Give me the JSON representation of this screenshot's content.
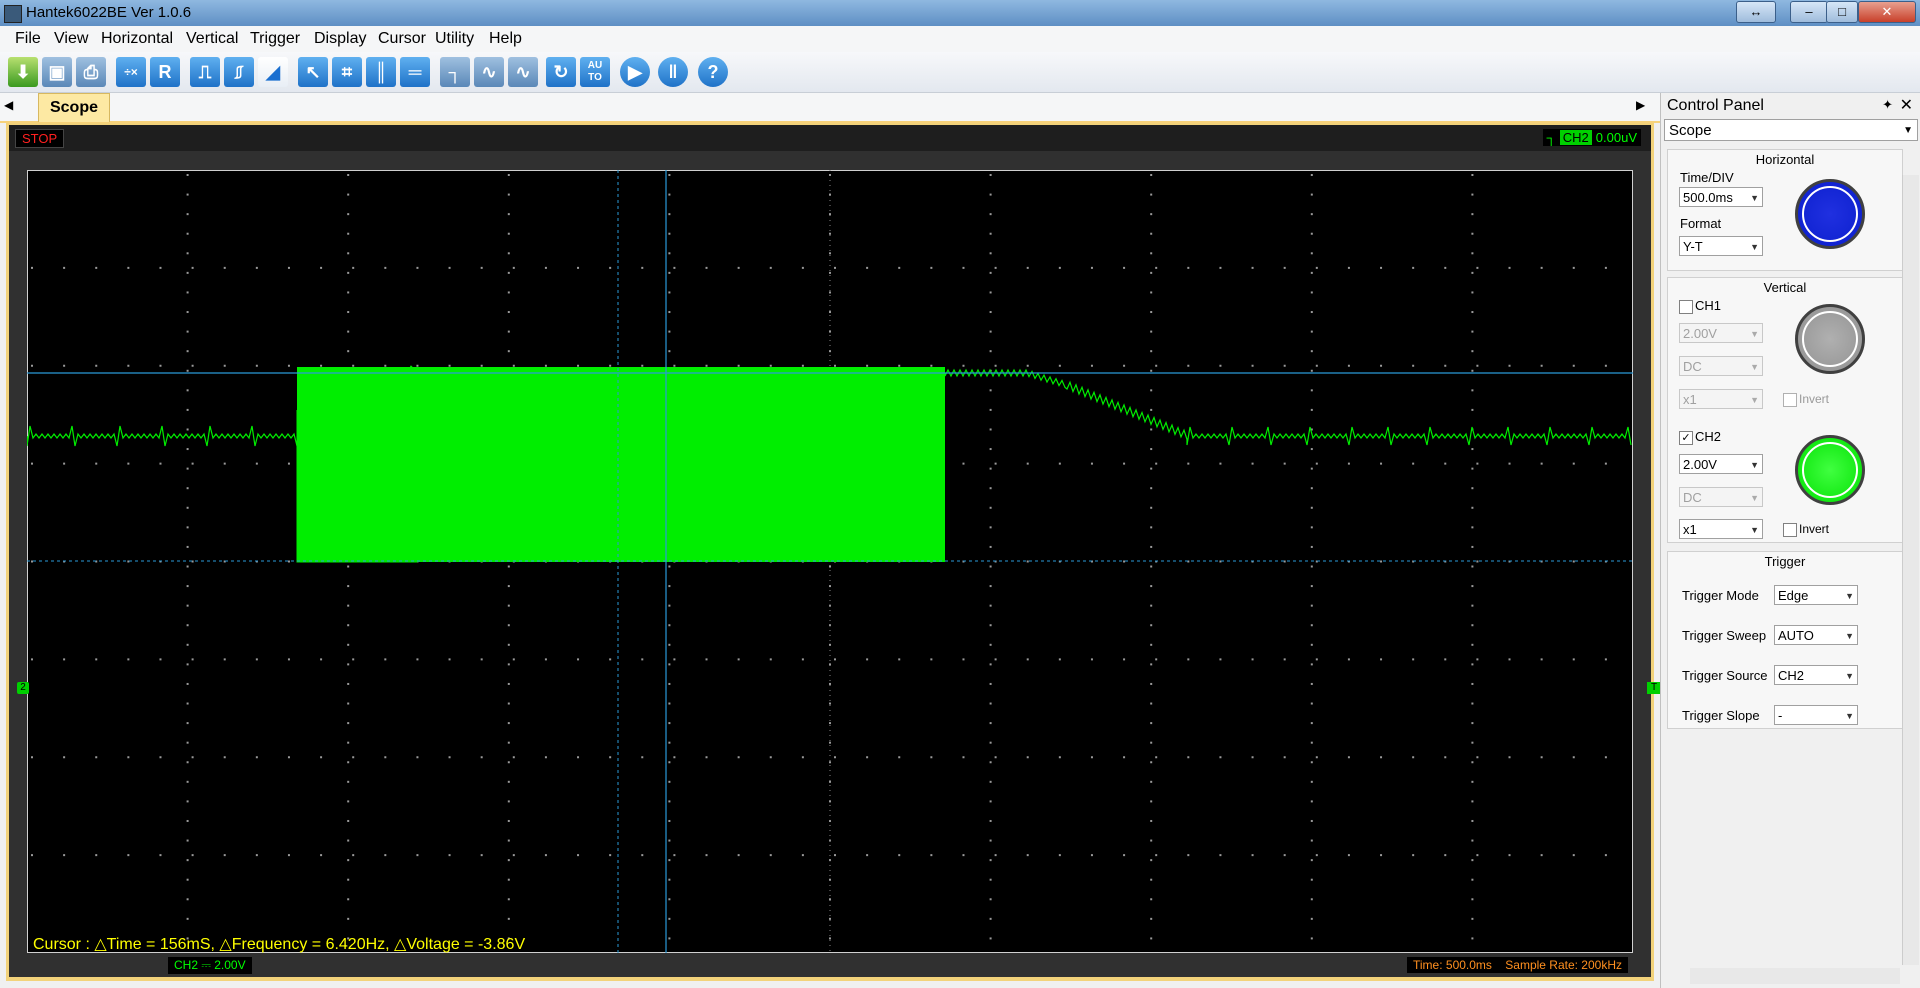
{
  "window": {
    "title": "Hantek6022BE Ver 1.0.6"
  },
  "menu": [
    "File",
    "View",
    "Horizontal",
    "Vertical",
    "Trigger",
    "Cursor",
    "Display",
    "Cursor",
    "Utility",
    "Help"
  ],
  "menu_items": {
    "file": "File",
    "view": "View",
    "horizontal": "Horizontal",
    "vertical": "Vertical",
    "trigger": "Trigger",
    "display": "Display",
    "cursor": "Cursor",
    "utility": "Utility",
    "help": "Help"
  },
  "toolbar": {
    "r_label": "R",
    "auto_label": "AU\nTO",
    "help_label": "?"
  },
  "tabs": {
    "scope": "Scope"
  },
  "scope": {
    "status": "STOP",
    "trigger_channel": "CH2",
    "trigger_level": "0.00uV",
    "cursor_readout": "Cursor : △Time = 156mS, △Frequency = 6.420Hz, △Voltage = -3.86V",
    "ch2_scale": "CH2 ⎓  2.00V",
    "time_div": "Time: 500.0ms",
    "sample_rate": "Sample Rate: 200kHz",
    "left_marker": "2",
    "right_marker": "T"
  },
  "control_panel": {
    "title": "Control Panel",
    "mode": "Scope",
    "horizontal": {
      "title": "Horizontal",
      "time_div_label": "Time/DIV",
      "time_div": "500.0ms",
      "format_label": "Format",
      "format": "Y-T"
    },
    "vertical": {
      "title": "Vertical",
      "ch1": {
        "label": "CH1",
        "checked": false,
        "volts": "2.00V",
        "coupling": "DC",
        "probe": "x1",
        "invert_label": "Invert"
      },
      "ch2": {
        "label": "CH2",
        "checked": true,
        "volts": "2.00V",
        "coupling": "DC",
        "probe": "x1",
        "invert_label": "Invert"
      }
    },
    "trigger": {
      "title": "Trigger",
      "mode_label": "Trigger Mode",
      "mode": "Edge",
      "sweep_label": "Trigger Sweep",
      "sweep": "AUTO",
      "source_label": "Trigger Source",
      "source": "CH2",
      "slope_label": "Trigger Slope",
      "slope": "-"
    }
  },
  "colors": {
    "trace": "#00ee00",
    "grid_bg": "#000000",
    "cursor_line": "#2a9ad8",
    "readout": "#ffff00",
    "knob_time": "#0a1ecc",
    "knob_ch1": "#909090",
    "knob_ch2": "#00f000"
  }
}
